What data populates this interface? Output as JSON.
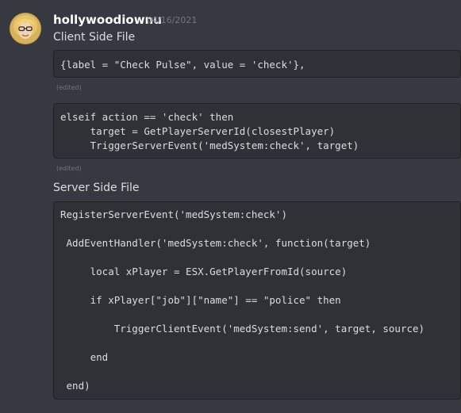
{
  "message": {
    "author": "hollywoodiownu",
    "timestamp": "04/16/2021",
    "avatar_icon": "avatar-icon",
    "lines": {
      "client_heading": "Client Side File",
      "server_heading": "Server Side File"
    },
    "code_blocks": {
      "client_table": "{label = \"Check Pulse\", value = 'check'},",
      "client_handler": "elseif action == 'check' then\n     target = GetPlayerServerId(closestPlayer)\n     TriggerServerEvent('medSystem:check', target)",
      "server_code": "RegisterServerEvent('medSystem:check')\n\n AddEventHandler('medSystem:check', function(target)\n\n     local xPlayer = ESX.GetPlayerFromId(source)\n\n     if xPlayer[\"job\"][\"name\"] == \"police\" then\n\n         TriggerClientEvent('medSystem:send', target, source)\n\n     end\n\n end)"
    },
    "edited_label_1": "(edited)",
    "edited_label_2": "(edited)"
  },
  "colors": {
    "background": "#36393f",
    "code_background": "#2f3136",
    "code_border": "#202225",
    "username": "#ffffff",
    "text": "#dcddde",
    "muted": "#72767d"
  }
}
